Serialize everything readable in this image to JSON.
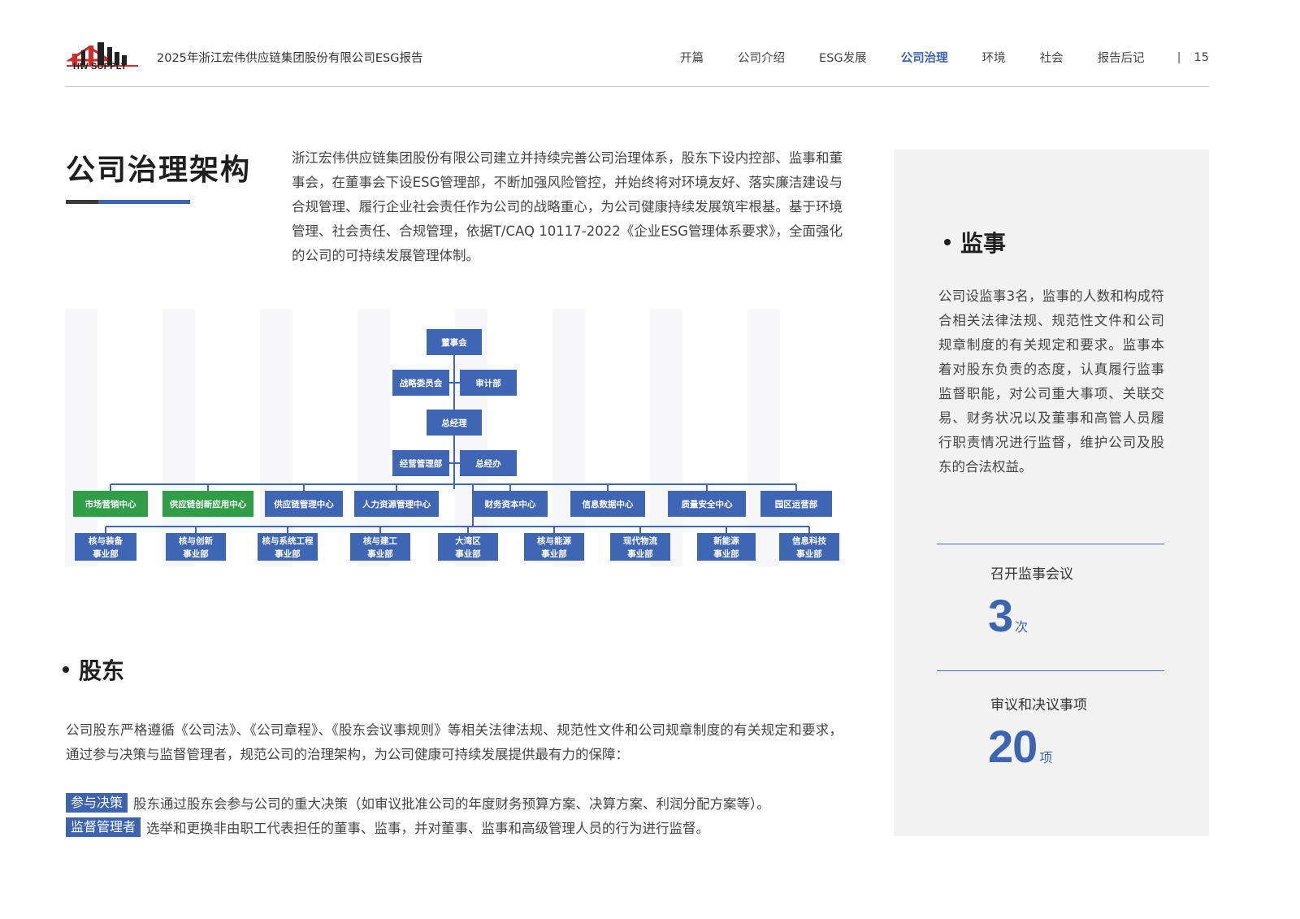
{
  "header": {
    "logo_text": "HW SUPPLY",
    "report_title": "2025年浙江宏伟供应链集团股份有限公司ESG报告",
    "nav": [
      "开篇",
      "公司介绍",
      "ESG发展",
      "公司治理",
      "环境",
      "社会",
      "报告后记"
    ],
    "active_nav": "公司治理",
    "separator": "|",
    "page_number": "15"
  },
  "colors": {
    "accent": "#3c64b1",
    "chart_blue": "#3f66b5",
    "chart_green": "#2f9e47",
    "panel_bg": "#f2f2f3"
  },
  "section": {
    "title": "公司治理架构",
    "intro": "浙江宏伟供应链集团股份有限公司建立并持续完善公司治理体系，股东下设内控部、监事和董事会，在董事会下设ESG管理部，不断加强风险管控，并始终将对环境友好、落实廉洁建设与合规管理、履行企业社会责任作为公司的战略重心，为公司健康持续发展筑牢根基。基于环境管理、社会责任、合规管理，依据T/CAQ 10117-2022《企业ESG管理体系要求》，全面强化的公司的可持续发展管理体制。"
  },
  "org_chart": {
    "board": "董事会",
    "board_committees": [
      "战略委员会",
      "审计部"
    ],
    "general_manager": "总经理",
    "gm_offices": [
      "经营管理部",
      "总经办"
    ],
    "centers": [
      {
        "label": "市场营销中心",
        "color": "green"
      },
      {
        "label": "供应链创新应用中心",
        "color": "green"
      },
      {
        "label": "供应链管理中心",
        "color": "blue"
      },
      {
        "label": "人力资源管理中心",
        "color": "blue"
      },
      {
        "label": "财务资本中心",
        "color": "blue"
      },
      {
        "label": "信息数据中心",
        "color": "blue"
      },
      {
        "label": "质量安全中心",
        "color": "blue"
      },
      {
        "label": "园区运营部",
        "color": "blue"
      }
    ],
    "business_units": [
      {
        "line1": "核与装备",
        "line2": "事业部"
      },
      {
        "line1": "核与创新",
        "line2": "事业部"
      },
      {
        "line1": "核与系统工程",
        "line2": "事业部"
      },
      {
        "line1": "核与建工",
        "line2": "事业部"
      },
      {
        "line1": "大湾区",
        "line2": "事业部"
      },
      {
        "line1": "核与能源",
        "line2": "事业部"
      },
      {
        "line1": "现代物流",
        "line2": "事业部"
      },
      {
        "line1": "新能源",
        "line2": "事业部"
      },
      {
        "line1": "信息科技",
        "line2": "事业部"
      }
    ]
  },
  "shareholders": {
    "heading": "股东",
    "body": "公司股东严格遵循《公司法》、《公司章程》、《股东会议事规则》等相关法律法规、规范性文件和公司规章制度的有关规定和要求，通过参与决策与监督管理者，规范公司的治理架构，为公司健康可持续发展提供最有力的保障：",
    "items": [
      {
        "tag": "参与决策",
        "text": "股东通过股东会参与公司的重大决策（如审议批准公司的年度财务预算方案、决算方案、利润分配方案等）。"
      },
      {
        "tag": "监督管理者",
        "text": "选举和更换非由职工代表担任的董事、监事，并对董事、监事和高级管理人员的行为进行监督。"
      }
    ]
  },
  "supervisors": {
    "heading": "监事",
    "body": "公司设监事3名，监事的人数和构成符合相关法律法规、规范性文件和公司规章制度的有关规定和要求。监事本着对股东负责的态度，认真履行监事监督职能，对公司重大事项、关联交易、财务状况以及董事和高管人员履行职责情况进行监督，维护公司及股东的合法权益。",
    "stats": [
      {
        "label": "召开监事会议",
        "value": "3",
        "unit": "次"
      },
      {
        "label": "审议和决议事项",
        "value": "20",
        "unit": "项"
      }
    ]
  }
}
